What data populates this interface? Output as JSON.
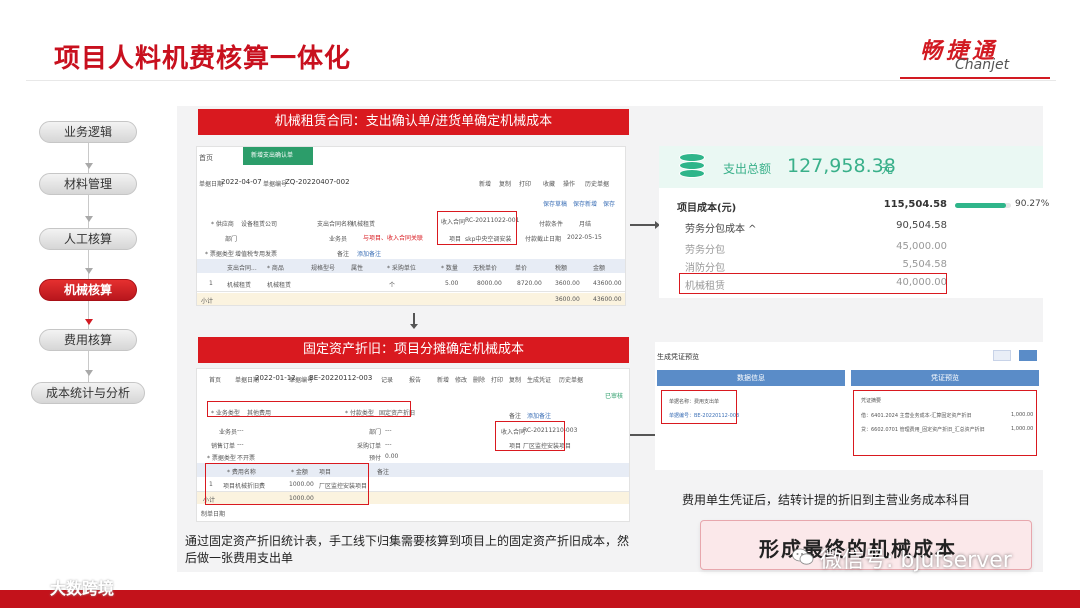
{
  "slide": {
    "title": "项目人料机费核算一体化",
    "logo_cn": "畅捷通",
    "logo_en": "Chanjet"
  },
  "nav": {
    "items": [
      {
        "label": "业务逻辑"
      },
      {
        "label": "材料管理"
      },
      {
        "label": "人工核算"
      },
      {
        "label": "机械核算",
        "active": true
      },
      {
        "label": "费用核算"
      },
      {
        "label": "成本统计与分析"
      }
    ]
  },
  "section_top": {
    "banner": "机械租赁合同：支出确认单/进货单确定机械成本",
    "screenshot": {
      "home_tab": "首页",
      "doc_tab": "新增支出确认单",
      "date_label": "单据日期",
      "date": "2022-04-07",
      "no_label": "单据编号",
      "no": "ZQ-20220407-002",
      "toolbar": [
        "新增",
        "复制",
        "打印",
        "收藏",
        "操作",
        "历史单据"
      ],
      "action_buttons": [
        "保存草稿",
        "保存新增",
        "保存"
      ],
      "supplier_label": "* 供应商",
      "supplier": "设备租赁公司",
      "contract_label": "支出合同名称",
      "contract": "机械租赁",
      "income_label": "收入合同",
      "income": "RC-20211022-001",
      "pay_term_label": "付款条件",
      "pay_term": "月结",
      "dept_label": "部门",
      "staff_label": "业务员",
      "project_label": "项目",
      "project": "skp中央空调安装",
      "due_label": "付款截止日期",
      "due": "2022-05-15",
      "tax_label": "* 票据类型",
      "tax": "增值税专用发票",
      "memo_label": "备注",
      "memo_link": "添加备注",
      "annotation": "与项目、收入合同关联",
      "columns": [
        "支出合同...",
        "* 商品",
        "规格型号",
        "属性",
        "* 采购单位",
        "* 数量",
        "无税单价",
        "单价",
        "税额",
        "金额"
      ],
      "row": {
        "idx": "1",
        "contract": "机械租赁",
        "item": "机械租赁",
        "unit": "个",
        "qty": "5.00",
        "price_ex": "8000.00",
        "price": "8720.00",
        "tax": "3600.00",
        "amount": "43600.00"
      },
      "total_label": "小计",
      "total_tax": "3600.00",
      "total_amount": "43600.00"
    }
  },
  "section_bottom": {
    "banner": "固定资产折旧：项目分摊确定机械成本",
    "screenshot": {
      "home_tab": "首页",
      "date_label": "单据日期",
      "date": "2022-01-12",
      "no_label": "单据编号",
      "no": "BE-20220112-003",
      "toolbar": [
        "记录",
        "报告",
        "新增",
        "修改",
        "删除",
        "打印",
        "复制",
        "生成凭证",
        "历史单据"
      ],
      "status": "已审核",
      "biz_type_label": "* 业务类型",
      "biz_type": "其他费用",
      "pay_type_label": "* 付款类型",
      "pay_type": "固定资产折旧",
      "staff_label": "业务员",
      "staff": "---",
      "dept_label": "部门",
      "dept": "---",
      "order_label": "销售订单",
      "order": "---",
      "purchase_label": "采购订单",
      "purchase": "---",
      "tax_label": "* 票据类型",
      "tax": "不开票",
      "receipt_label": "预付",
      "receipt": "0.00",
      "memo_label": "备注",
      "memo_link": "添加备注",
      "income_label": "收入合同",
      "income": "RC-20211210-003",
      "project_label": "项目",
      "project": "厂区监控安装项目",
      "columns": [
        "* 费用名称",
        "* 金额",
        "项目",
        "备注"
      ],
      "row": {
        "idx": "1",
        "name": "项目机械折旧费",
        "amount": "1000.00",
        "project": "厂区监控安装项目"
      },
      "total_label": "小计",
      "total": "1000.00",
      "maker_label": "制单日期"
    }
  },
  "cost_summary": {
    "total_label": "支出总额",
    "total_value": "127,958.38",
    "total_unit": "元",
    "rows": [
      {
        "label": "项目成本(元)",
        "value": "115,504.58",
        "style": "bold"
      },
      {
        "label": "劳务分包成本 ^",
        "value": "90,504.58",
        "style": "normal"
      },
      {
        "label": "劳务分包",
        "value": "45,000.00",
        "style": "sub"
      },
      {
        "label": "消防分包",
        "value": "5,504.58",
        "style": "sub"
      },
      {
        "label": "机械租赁",
        "value": "40,000.00",
        "style": "sub"
      }
    ],
    "percent": "90.27%",
    "percent_value": 0.9027
  },
  "voucher_preview": {
    "title": "生成凭证预览",
    "col_left": "数据信息",
    "col_right": "凭证预览",
    "left_lines": [
      "单据名称：费用支出单",
      "单据编号：BE-20220112-003"
    ],
    "right_header": "凭证摘要",
    "right_lines": [
      {
        "text": "借：6401.2024  主营业务成本-汇算固定资产折旧",
        "amount": "1,000.00"
      },
      {
        "text": "贷：6602.0701  管理费用_固定资产折旧_汇总资产折旧",
        "amount": "1,000.00"
      }
    ]
  },
  "notes": {
    "right": "费用单生凭证后，结转计提的折旧到主营业务成本科目",
    "left": "通过固定资产折旧统计表，手工线下归集需要核算到项目上的固定资产折旧成本，然后做一张费用支出单",
    "result": "形成最终的机械成本"
  },
  "watermark": {
    "text": "微信号: bjufserver",
    "brand": "大数跨境"
  },
  "colors": {
    "brand_red": "#d9191f",
    "accent_green": "#39b08a"
  }
}
